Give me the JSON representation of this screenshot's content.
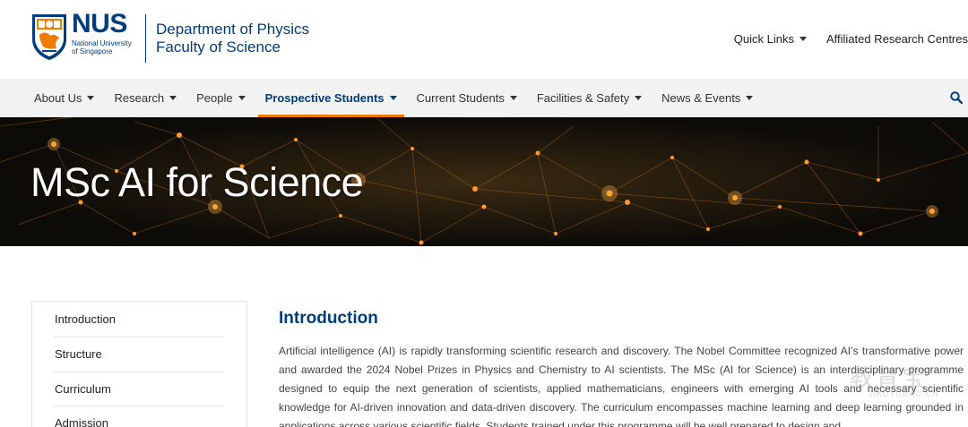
{
  "header": {
    "logo": {
      "wordmark": "NUS",
      "line1": "National University",
      "line2": "of Singapore"
    },
    "department": "Department of Physics",
    "faculty": "Faculty of Science",
    "top_links": [
      {
        "label": "Quick Links"
      },
      {
        "label": "Affiliated Research Centres"
      }
    ]
  },
  "nav": {
    "items": [
      {
        "label": "About Us"
      },
      {
        "label": "Research"
      },
      {
        "label": "People"
      },
      {
        "label": "Prospective Students",
        "active": true
      },
      {
        "label": "Current Students"
      },
      {
        "label": "Facilities & Safety"
      },
      {
        "label": "News & Events"
      }
    ],
    "search_icon": "search-icon"
  },
  "banner": {
    "title": "MSc AI for Science"
  },
  "sidebar": {
    "items": [
      {
        "label": "Introduction"
      },
      {
        "label": "Structure"
      },
      {
        "label": "Curriculum"
      },
      {
        "label": "Admission"
      }
    ]
  },
  "main": {
    "heading": "Introduction",
    "paragraph": "Artificial intelligence (AI) is rapidly transforming scientific research and discovery. The Nobel Committee recognized AI’s transformative power and awarded the 2024 Nobel Prizes in Physics and Chemistry to AI scientists. The MSc (AI for Science) is an interdisciplinary programme designed to equip the next generation of scientists, applied mathematicians, engineers with emerging AI tools and necessary scientific knowledge for AI-driven innovation and data-driven discovery. The curriculum encompasses machine learning and deep learning grounded in applications across various scientific fields. Students trained under this programme will be well prepared to design and"
  },
  "watermark": {
    "cn": "教育宝",
    "en": "JIAOYUBAO.CN"
  },
  "colors": {
    "brand_blue": "#003d7c",
    "accent_orange": "#ef7c00",
    "nav_bg": "#f2f2f2"
  }
}
